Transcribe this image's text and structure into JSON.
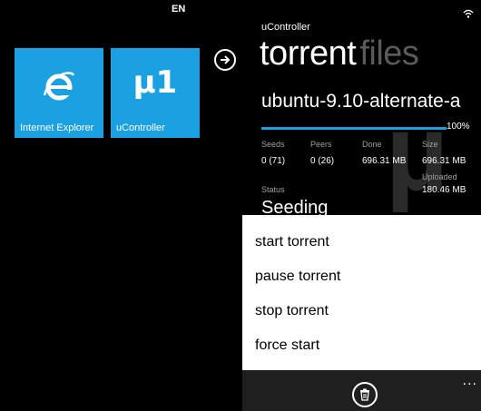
{
  "start": {
    "language": "EN",
    "tiles": [
      {
        "label": "Internet Explorer",
        "icon": "internet-explorer-icon"
      },
      {
        "label": "uController",
        "icon": "utorrent-icon",
        "glyph": "µ1"
      }
    ],
    "arrow_icon": "arrow-right-icon"
  },
  "app": {
    "name": "uController",
    "pivot_active": "torrent",
    "pivot_inactive": "files",
    "torrent_name": "ubuntu-9.10-alternate-a",
    "progress_pct": 100,
    "progress_label": "100%",
    "stats": {
      "headers": [
        "Seeds",
        "Peers",
        "Done",
        "Size"
      ],
      "values": [
        "0 (71)",
        "0 (26)",
        "696.31 MB",
        "696.31 MB"
      ]
    },
    "uploaded_label": "Uploaded",
    "uploaded_value": "180.46 MB",
    "status_label": "Status",
    "status_value": "Seeding",
    "menu": [
      "start torrent",
      "pause torrent",
      "stop torrent",
      "force start"
    ],
    "more_label": "...",
    "watermark": "µ"
  },
  "colors": {
    "accent": "#1ba1e2",
    "background": "#000000",
    "menu_bg": "#ffffff",
    "appbar_bg": "#1f1f1f"
  }
}
